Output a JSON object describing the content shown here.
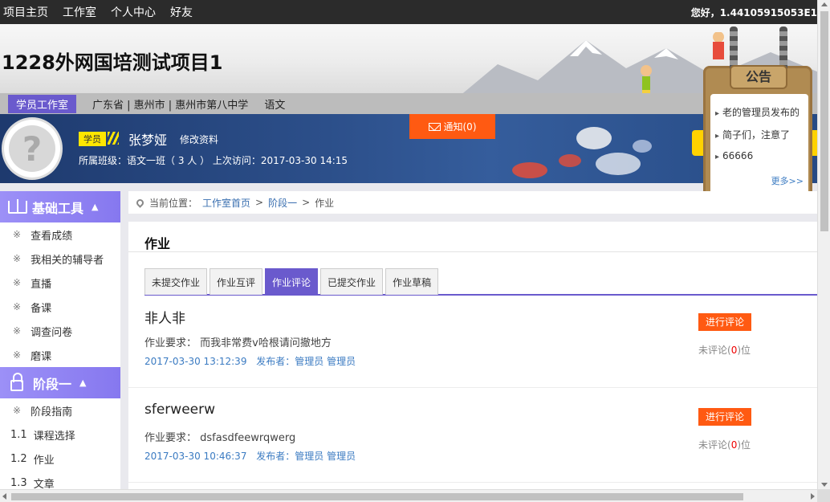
{
  "topnav": {
    "items": [
      "项目主页",
      "工作室",
      "个人中心",
      "好友"
    ],
    "greeting": "您好，1.44105915053E1"
  },
  "header": {
    "project_title": "1228外网国培测试项目1"
  },
  "location_bar": {
    "studio_tag": "学员工作室",
    "region": "广东省 | 惠州市 | 惠州市第八中学",
    "subject": "语文"
  },
  "profile": {
    "role": "学员",
    "name": "张梦娅",
    "edit_label": "修改资料",
    "class_info": "所属班级：语文一班（ 3 人 ）  上次访问：2017-03-30 14:15",
    "notify_label": "通知(0)"
  },
  "notice": {
    "title": "公告",
    "items": [
      "老的管理员发布的",
      "简子们，注意了",
      "66666"
    ],
    "more": "更多>>"
  },
  "sidebar": {
    "groups": [
      {
        "title": "基础工具",
        "caret": "▲",
        "items": [
          {
            "mark": "※",
            "label": "查看成绩"
          },
          {
            "mark": "※",
            "label": "我相关的辅导者"
          },
          {
            "mark": "※",
            "label": "直播"
          },
          {
            "mark": "※",
            "label": "备课"
          },
          {
            "mark": "※",
            "label": "调查问卷"
          },
          {
            "mark": "※",
            "label": "磨课"
          }
        ]
      },
      {
        "title": "阶段一",
        "caret": "▲",
        "items": [
          {
            "mark": "※",
            "label": "阶段指南"
          },
          {
            "mark": "1.1",
            "label": "课程选择"
          },
          {
            "mark": "1.2",
            "label": "作业"
          },
          {
            "mark": "1.3",
            "label": "文章"
          }
        ]
      }
    ]
  },
  "breadcrumb": {
    "prefix": "当前位置：",
    "links": [
      "工作室首页",
      "阶段一"
    ],
    "current": "作业",
    "separator": ">"
  },
  "main": {
    "heading": "作业",
    "tabs": [
      {
        "label": "未提交作业",
        "active": false
      },
      {
        "label": "作业互评",
        "active": false
      },
      {
        "label": "作业评论",
        "active": true
      },
      {
        "label": "已提交作业",
        "active": false
      },
      {
        "label": "作业草稿",
        "active": false
      }
    ],
    "homeworks": [
      {
        "title": "非人非",
        "requirement": "作业要求：  而我非常费v哈根请问撤地方",
        "date": "2017-03-30 13:12:39",
        "publisher": "发布者：管理员 管理员",
        "button": "进行评论",
        "count_prefix": "未评论(",
        "count": "0",
        "count_suffix": ")位"
      },
      {
        "title": "sferweerw",
        "requirement": "作业要求：  dsfasdfeewrqwerg",
        "date": "2017-03-30 10:46:37",
        "publisher": "发布者：管理员 管理员",
        "button": "进行评论",
        "count_prefix": "未评论(",
        "count": "0",
        "count_suffix": ")位"
      }
    ]
  },
  "colors": {
    "accent_purple": "#6a5acd",
    "sidebar_header": "#8b7ff0",
    "orange_button": "#ff5a12",
    "link_blue": "#3b7bc2",
    "topbar": "#2b2b2b"
  }
}
